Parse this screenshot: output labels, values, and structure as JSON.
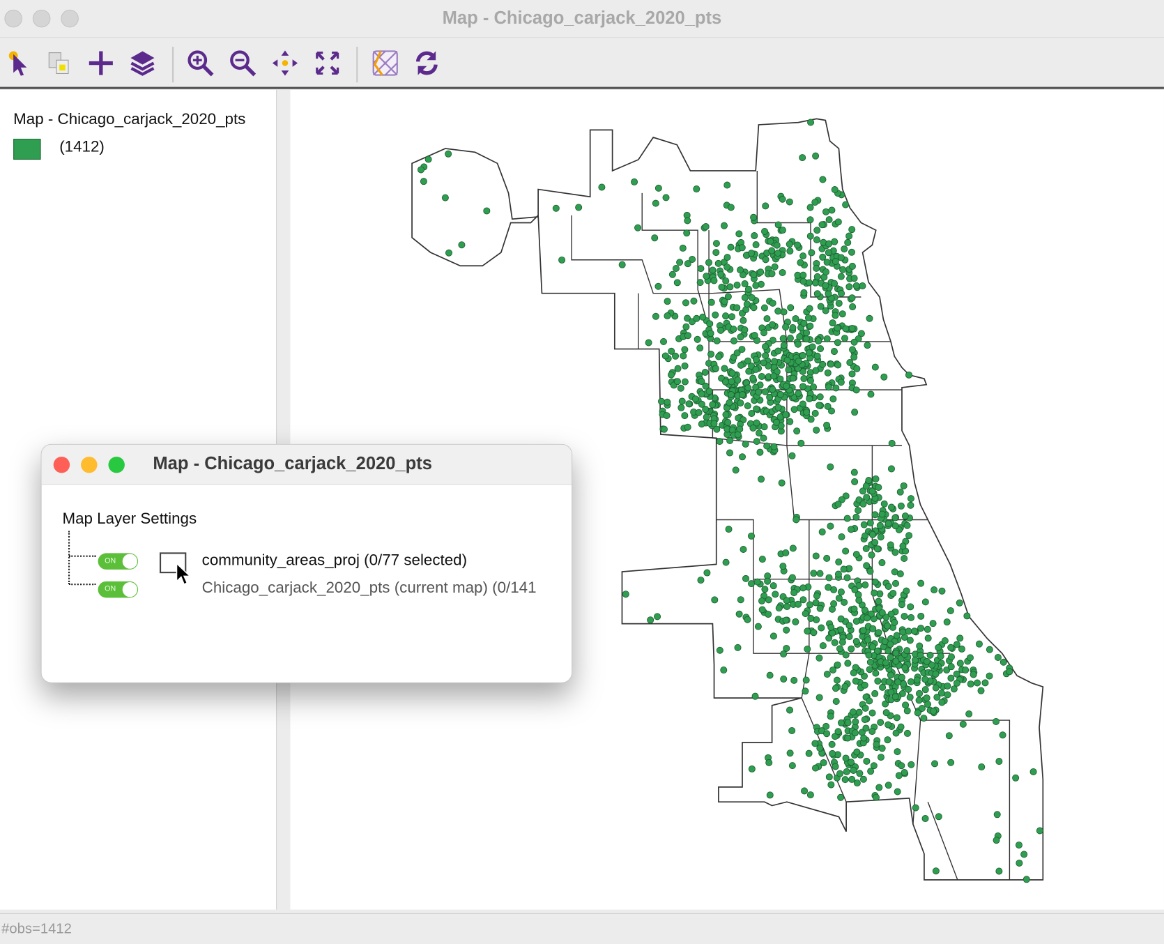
{
  "window": {
    "title": "Map - Chicago_carjack_2020_pts"
  },
  "toolbar": {
    "icons": [
      "select-pointer-icon",
      "selection-tool-icon",
      "add-layer-icon",
      "layers-icon",
      "zoom-in-icon",
      "zoom-out-icon",
      "pan-icon",
      "fit-extent-icon",
      "basemap-icon",
      "refresh-icon"
    ],
    "accent": "#5b2a8c"
  },
  "legend": {
    "title": "Map - Chicago_carjack_2020_pts",
    "swatch_color": "#2f9e51",
    "count": "(1412)"
  },
  "status": {
    "text": "#obs=1412"
  },
  "map": {
    "point_color": "#2f9e51",
    "boundary_color": "#333333"
  },
  "dialog": {
    "title": "Map - Chicago_carjack_2020_pts",
    "heading": "Map Layer Settings",
    "toggle_label": "ON",
    "layers": [
      {
        "name": "community_areas_proj (0/77 selected)",
        "on": true
      },
      {
        "name": "Chicago_carjack_2020_pts (current map) (0/141",
        "on": true
      }
    ]
  }
}
